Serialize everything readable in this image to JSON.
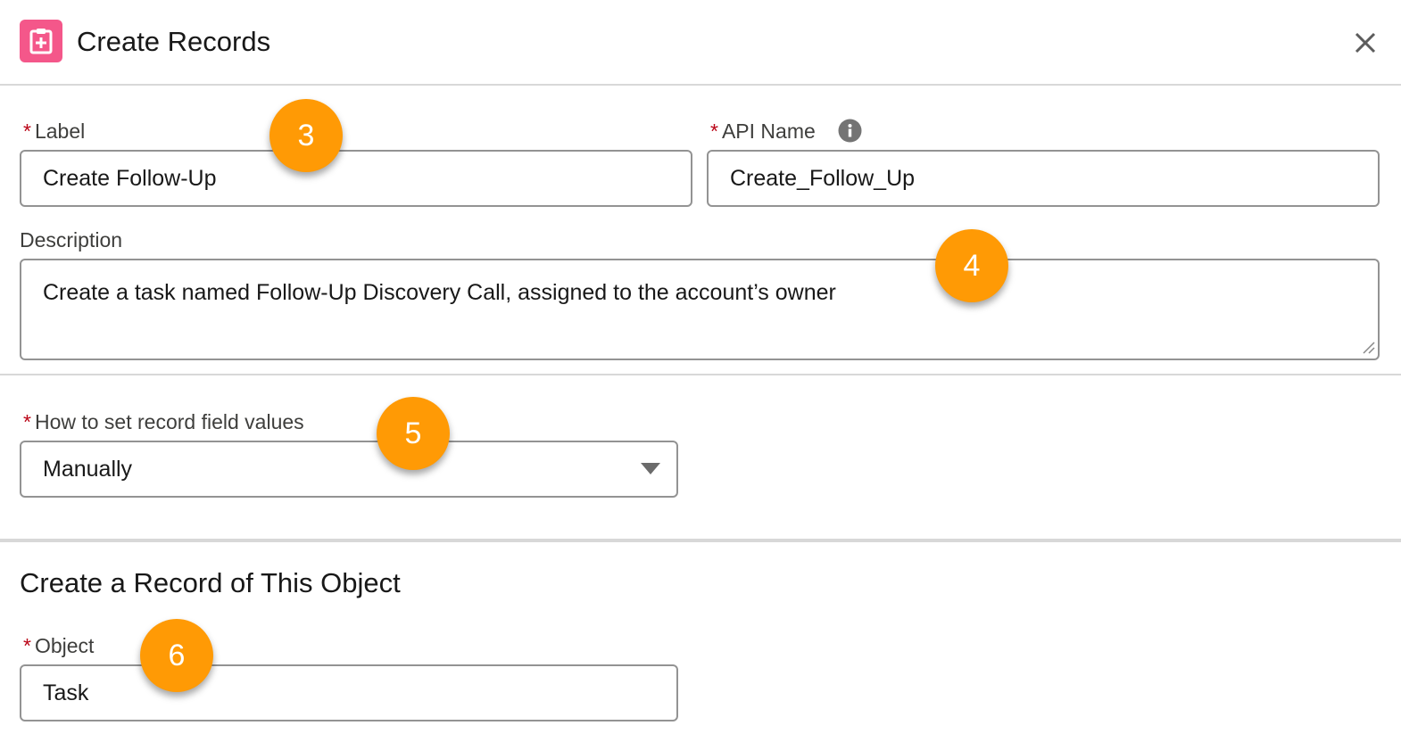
{
  "header": {
    "title": "Create Records",
    "icon": "create-records-icon",
    "close_icon": "close-icon"
  },
  "fields": {
    "label": {
      "label": "Label",
      "value": "Create Follow-Up",
      "required": "*"
    },
    "api_name": {
      "label": "API Name",
      "value": "Create_Follow_Up",
      "required": "*",
      "info_icon": "info-icon"
    },
    "description": {
      "label": "Description",
      "value": "Create a task named Follow-Up Discovery Call, assigned to the account’s owner"
    },
    "how_to_set": {
      "label": "How to set record field values",
      "value": "Manually",
      "required": "*"
    }
  },
  "section": {
    "title": "Create a Record of This Object",
    "object": {
      "label": "Object",
      "value": "Task",
      "required": "*"
    }
  },
  "callouts": [
    "3",
    "4",
    "5",
    "6"
  ],
  "colors": {
    "accent": "#f4578a",
    "callout": "#ff9a05",
    "required": "#ba0517"
  }
}
